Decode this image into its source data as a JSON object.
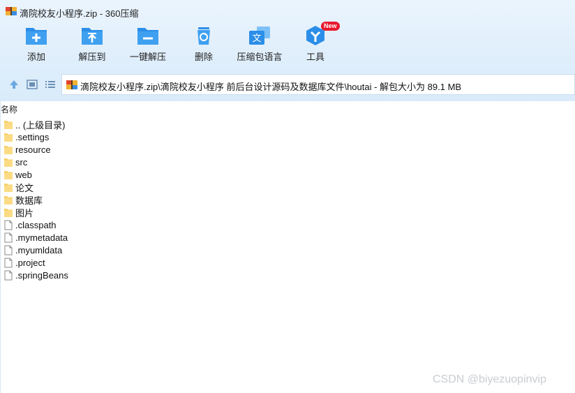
{
  "window": {
    "title": "滴院校友小程序.zip - 360压缩"
  },
  "toolbar": {
    "items": [
      {
        "label": "添加",
        "icon": "add-icon"
      },
      {
        "label": "解压到",
        "icon": "extract-to-icon"
      },
      {
        "label": "一键解压",
        "icon": "one-click-extract-icon"
      },
      {
        "label": "删除",
        "icon": "delete-icon"
      },
      {
        "label": "压缩包语言",
        "icon": "language-icon"
      },
      {
        "label": "工具",
        "icon": "tools-icon",
        "badge": "New"
      }
    ]
  },
  "address": {
    "path": "滴院校友小程序.zip\\滴院校友小程序 前后台设计源码及数据库文件\\houtai - 解包大小为 89.1 MB"
  },
  "list": {
    "column_name": "名称",
    "rows": [
      {
        "name": ".. (上级目录)",
        "type": "folder"
      },
      {
        "name": ".settings",
        "type": "folder"
      },
      {
        "name": "resource",
        "type": "folder"
      },
      {
        "name": "src",
        "type": "folder"
      },
      {
        "name": "web",
        "type": "folder"
      },
      {
        "name": "论文",
        "type": "folder"
      },
      {
        "name": "数据库",
        "type": "folder"
      },
      {
        "name": "图片",
        "type": "folder"
      },
      {
        "name": ".classpath",
        "type": "file"
      },
      {
        "name": ".mymetadata",
        "type": "file"
      },
      {
        "name": ".myumldata",
        "type": "file"
      },
      {
        "name": ".project",
        "type": "file"
      },
      {
        "name": ".springBeans",
        "type": "file"
      }
    ]
  },
  "watermark": "CSDN @biyezuopinvip",
  "colors": {
    "accent": "#2b8ee8",
    "folder": "#f7cd62",
    "badge": "#e8192c"
  }
}
